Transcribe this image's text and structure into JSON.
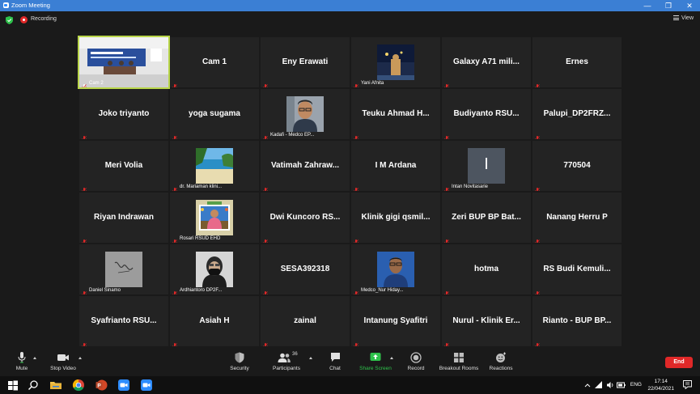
{
  "window": {
    "title": "Zoom Meeting",
    "controls": [
      "—",
      "❐",
      "✕"
    ]
  },
  "topbar": {
    "recording_label": "Recording",
    "view_label": "View"
  },
  "tiles": [
    {
      "name": "",
      "label": "Cam 2",
      "kind": "stage"
    },
    {
      "name": "Cam 1",
      "label": ""
    },
    {
      "name": "Eny Erawati",
      "label": ""
    },
    {
      "name": "",
      "label": "Yani Afnita",
      "kind": "photo-night"
    },
    {
      "name": "Galaxy A71 mili...",
      "label": ""
    },
    {
      "name": "Ernes",
      "label": ""
    },
    {
      "name": "Joko triyanto",
      "label": ""
    },
    {
      "name": "yoga sugama",
      "label": ""
    },
    {
      "name": "",
      "label": "Kadafi - Medco EP...",
      "kind": "photo-man"
    },
    {
      "name": "Teuku Ahmad H...",
      "label": ""
    },
    {
      "name": "Budiyanto RSU...",
      "label": ""
    },
    {
      "name": "Palupi_DP2FRZ...",
      "label": ""
    },
    {
      "name": "Meri Volia",
      "label": ""
    },
    {
      "name": "",
      "label": "dr. Mariaman klini...",
      "kind": "photo-beach"
    },
    {
      "name": "Vatimah Zahraw...",
      "label": ""
    },
    {
      "name": "I M Ardana",
      "label": ""
    },
    {
      "name": "",
      "label": "Intan Novitasarie",
      "kind": "initial",
      "initial": "I"
    },
    {
      "name": "770504",
      "label": ""
    },
    {
      "name": "Riyan Indrawan",
      "label": ""
    },
    {
      "name": "",
      "label": "Rosari RSUD EHD",
      "kind": "photo-frame"
    },
    {
      "name": "Dwi Kuncoro RS...",
      "label": ""
    },
    {
      "name": "Klinik gigi qsmil...",
      "label": ""
    },
    {
      "name": "Zeri BUP BP Bat...",
      "label": ""
    },
    {
      "name": "Nanang Herru P",
      "label": ""
    },
    {
      "name": "",
      "label": "Daniel Sinamo",
      "kind": "photo-sign"
    },
    {
      "name": "",
      "label": "Ardhiantoro DP2F...",
      "kind": "photo-mask"
    },
    {
      "name": "SESA392318",
      "label": ""
    },
    {
      "name": "",
      "label": "Medco_Nur Hiday...",
      "kind": "photo-blue"
    },
    {
      "name": "hotma",
      "label": ""
    },
    {
      "name": "RS Budi Kemuli...",
      "label": ""
    },
    {
      "name": "Syafrianto RSU...",
      "label": ""
    },
    {
      "name": "Asiah H",
      "label": ""
    },
    {
      "name": "zainal",
      "label": ""
    },
    {
      "name": "Intanung Syafitri",
      "label": ""
    },
    {
      "name": "Nurul - Klinik Er...",
      "label": ""
    },
    {
      "name": "Rianto - BUP BP...",
      "label": ""
    }
  ],
  "controls": {
    "mute": "Mute",
    "stop_video": "Stop Video",
    "security": "Security",
    "participants": "Participants",
    "participants_count": "36",
    "chat": "Chat",
    "share_screen": "Share Screen",
    "record": "Record",
    "breakout_rooms": "Breakout Rooms",
    "reactions": "Reactions",
    "end": "End"
  },
  "colors": {
    "share_green": "#2ec24b",
    "end_red": "#e02828",
    "titlebar_blue": "#3b7fd4",
    "active_outline": "#b9d64a"
  },
  "taskbar": {
    "items": [
      "windows-start",
      "search",
      "file-explorer",
      "chrome",
      "powerpoint",
      "zoom",
      "zoom"
    ],
    "lang": "ENG",
    "time": "17:14",
    "date": "22/04/2021"
  }
}
